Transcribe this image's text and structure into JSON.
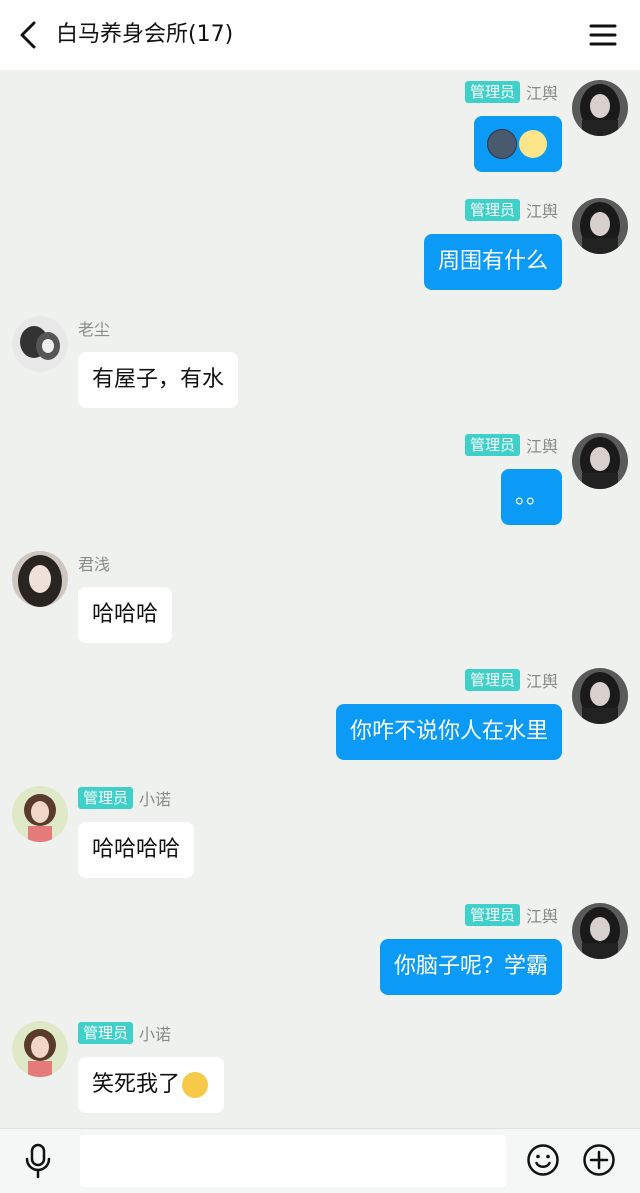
{
  "header": {
    "title": "白马养身会所(17)"
  },
  "messages": [
    {
      "side": "right",
      "admin": true,
      "badge": "管理员",
      "name": "江舆",
      "text": "",
      "emojis": [
        "new-moon-face",
        "first-quarter-moon-face"
      ]
    },
    {
      "side": "right",
      "admin": true,
      "badge": "管理员",
      "name": "江舆",
      "text": "周围有什么"
    },
    {
      "side": "left",
      "admin": false,
      "name": "老尘",
      "text": "有屋子，有水"
    },
    {
      "side": "right",
      "admin": true,
      "badge": "管理员",
      "name": "江舆",
      "text": "。。"
    },
    {
      "side": "left",
      "admin": false,
      "name": "君浅",
      "text": "哈哈哈"
    },
    {
      "side": "right",
      "admin": true,
      "badge": "管理员",
      "name": "江舆",
      "text": "你咋不说你人在水里"
    },
    {
      "side": "left",
      "admin": true,
      "badge": "管理员",
      "name": "小诺",
      "text": "哈哈哈哈"
    },
    {
      "side": "right",
      "admin": true,
      "badge": "管理员",
      "name": "江舆",
      "text": "你脑子呢？学霸"
    },
    {
      "side": "left",
      "admin": true,
      "badge": "管理员",
      "name": "小诺",
      "text": "笑死我了",
      "emojis": [
        "laughing-face"
      ]
    }
  ],
  "input": {
    "value": "",
    "placeholder": ""
  },
  "colors": {
    "background": "#eef1ee",
    "bubble_self": "#0b9af5",
    "bubble_other": "#ffffff",
    "admin_badge": "#3fd0c9"
  }
}
